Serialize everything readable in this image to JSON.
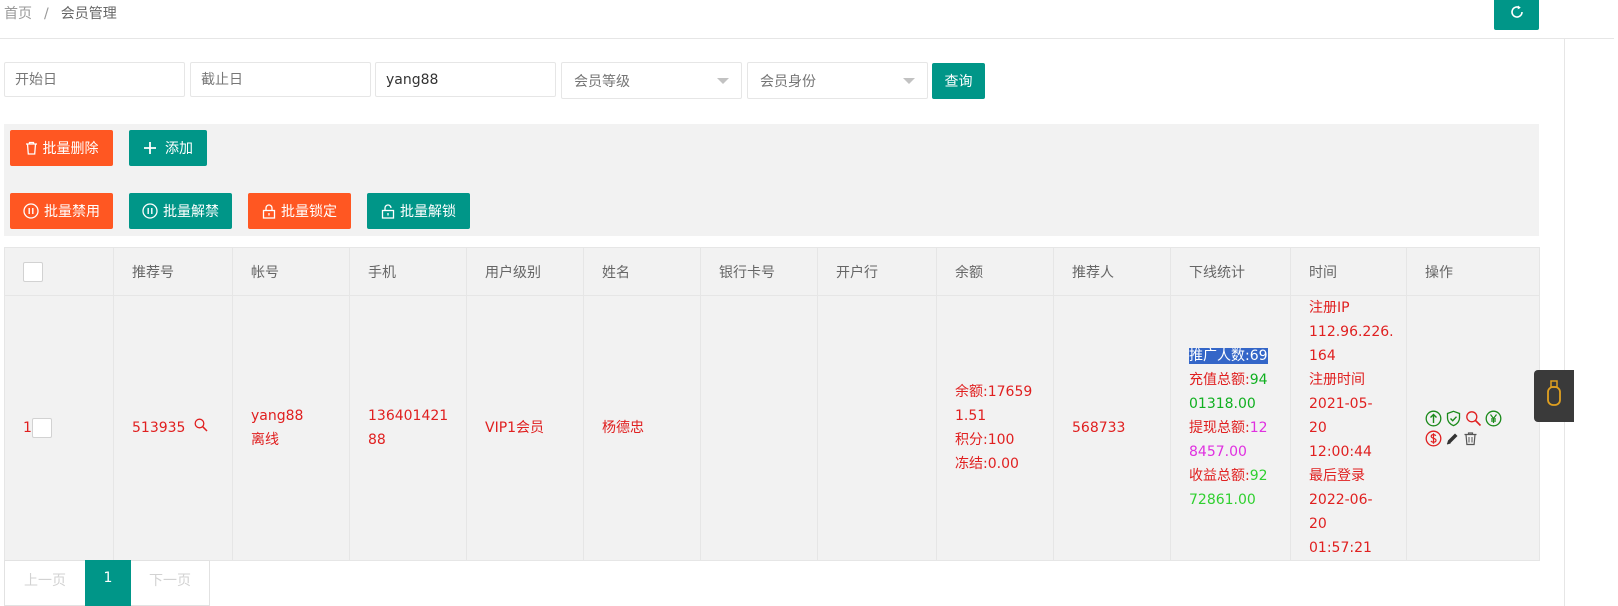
{
  "breadcrumb": {
    "home": "首页",
    "sep": "/",
    "current": "会员管理"
  },
  "filters": {
    "start_date_placeholder": "开始日",
    "end_date_placeholder": "截止日",
    "keyword_value": "yang88",
    "level_select": "会员等级",
    "role_select": "会员身份",
    "query_label": "查询"
  },
  "toolbar": {
    "batch_delete": "批量删除",
    "add": "添加",
    "batch_disable": "批量禁用",
    "batch_enable": "批量解禁",
    "batch_lock": "批量锁定",
    "batch_unlock": "批量解锁"
  },
  "table": {
    "headers": [
      "推荐号",
      "帐号",
      "手机",
      "用户级别",
      "姓名",
      "银行卡号",
      "开户行",
      "余额",
      "推荐人",
      "下线统计",
      "时间",
      "操作"
    ],
    "row": {
      "index": "1",
      "ref_no": "513935",
      "account": "yang88",
      "status": "离线",
      "phone_a": "136401421",
      "phone_b": "88",
      "level": "VIP1会员",
      "name": "杨德忠",
      "bank_card": "",
      "bank": "",
      "balance_a": "余额:17659",
      "balance_b": "1.51",
      "points": "积分:100",
      "frozen": "冻结:0.00",
      "referrer": "568733",
      "stats": {
        "promo_label": "推广人数:",
        "promo_value": "69",
        "recharge_label": "充值总额:",
        "recharge_a": "94",
        "recharge_b": "01318.00",
        "withdraw_label": "提现总额:",
        "withdraw_a": "12",
        "withdraw_b": "8457.00",
        "income_label": "收益总额:",
        "income_a": "92",
        "income_b": "72861.00"
      },
      "time": {
        "reg_ip_label": "注册IP",
        "reg_ip_a": "112.96.226.",
        "reg_ip_b": "164",
        "reg_time_label": "注册时间",
        "reg_date": "2021-05-20",
        "reg_clock": "12:00:44",
        "last_login_label": "最后登录",
        "last_date": "2022-06-20",
        "last_clock": "01:57:21"
      }
    }
  },
  "pager": {
    "prev": "上一页",
    "current": "1",
    "next": "下一页"
  }
}
